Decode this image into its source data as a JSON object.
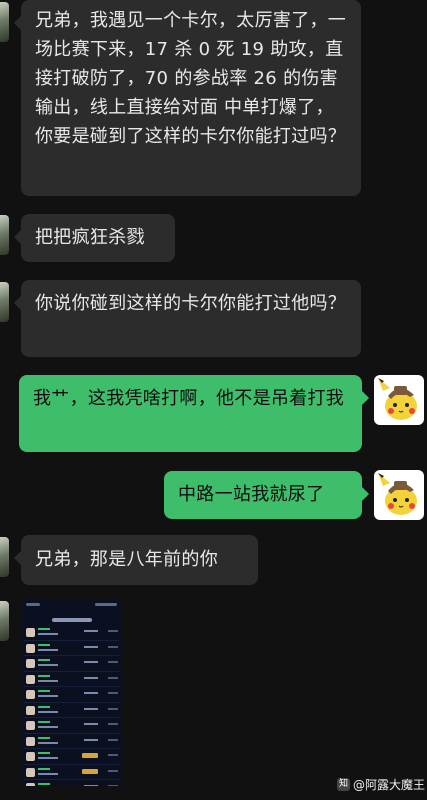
{
  "messages": [
    {
      "side": "in",
      "text": "兄弟，我遇见一个卡尔，太厉害了，一场比赛下来，17 杀 0 死 19 助攻，直接打破防了，70 的参战率 26 的伤害输出，线上直接给对面 中单打爆了，你要是碰到了这样的卡尔你能打过吗？"
    },
    {
      "side": "in",
      "text": "把把疯狂杀戮"
    },
    {
      "side": "in",
      "text": "你说你碰到这样的卡尔你能打过他吗？"
    },
    {
      "side": "out",
      "text": "我艹，这我凭啥打啊，他不是吊着打我"
    },
    {
      "side": "out",
      "text": "中路一站我就尿了"
    },
    {
      "side": "in",
      "text": "兄弟，那是八年前的你"
    }
  ],
  "watermark": {
    "logo": "知",
    "text": "@阿露大魔王"
  },
  "colors": {
    "background": "#111111",
    "incoming_bubble": "#2c2c2c",
    "outgoing_bubble": "#3ebd6a"
  }
}
